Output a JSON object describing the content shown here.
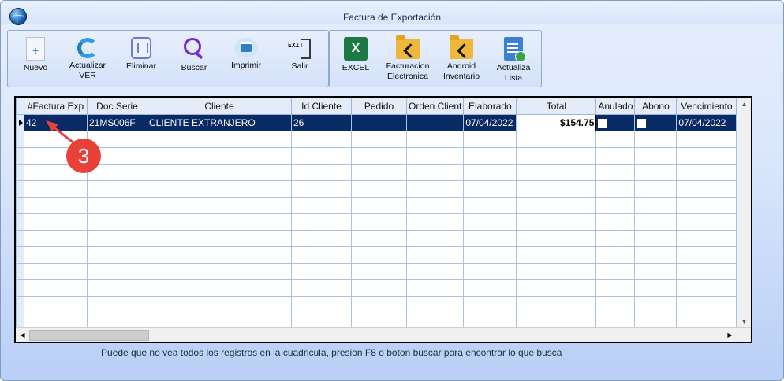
{
  "window": {
    "title": "Factura de Exportación"
  },
  "toolbar": {
    "group1": [
      {
        "label": "Nuevo",
        "icon": "new-document-icon"
      },
      {
        "label": "Actualizar\nVER",
        "icon": "refresh-icon"
      },
      {
        "label": "Eliminar",
        "icon": "trash-icon"
      },
      {
        "label": "Buscar",
        "icon": "search-icon"
      },
      {
        "label": "Imprimir",
        "icon": "printer-icon"
      },
      {
        "label": "Salir",
        "icon": "exit-icon"
      }
    ],
    "group2": [
      {
        "label": "EXCEL",
        "icon": "excel-icon"
      },
      {
        "label": "Facturacion\nElectronica",
        "icon": "folder-arrow-icon"
      },
      {
        "label": "Android\nInventario",
        "icon": "folder-arrow-icon"
      },
      {
        "label": "Actualiza\nLista",
        "icon": "list-refresh-icon"
      }
    ]
  },
  "grid": {
    "columns": [
      "#Factura Exp",
      "Doc Serie",
      "Cliente",
      "Id Cliente",
      "Pedido",
      "Orden Client",
      "Elaborado",
      "Total",
      "Anulado",
      "Abono",
      "Vencimiento"
    ],
    "rows": [
      {
        "factura": "42",
        "doc_serie": "21MS006F",
        "cliente": "CLIENTE EXTRANJERO",
        "id_cliente": "26",
        "pedido": "",
        "orden": "",
        "elaborado": "07/04/2022",
        "total": "$154.75",
        "anulado": false,
        "abono": false,
        "vencimiento": "07/04/2022"
      }
    ]
  },
  "hint": "Puede que no vea todos los registros en la cuadricula, presion F8 o boton buscar para encontrar lo que busca",
  "annotation": {
    "number": "3",
    "color": "#e8413a"
  },
  "colors": {
    "selection": "#0a2a66",
    "header_bg": "#e4ecf8",
    "gridline": "#a9c2e4"
  }
}
